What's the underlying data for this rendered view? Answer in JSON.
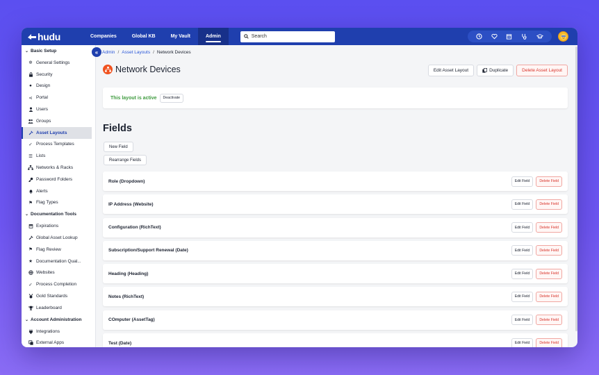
{
  "colors": {
    "nav_bg": "#1f3fae",
    "accent": "#2a57d8",
    "danger": "#d8332a",
    "success": "#3f9b3f",
    "title_icon": "#f0521f"
  },
  "brand": {
    "name": "hudu"
  },
  "nav": {
    "items": [
      {
        "label": "Companies"
      },
      {
        "label": "Global KB"
      },
      {
        "label": "My Vault"
      },
      {
        "label": "Admin",
        "active": true
      }
    ],
    "search_placeholder": "Search",
    "icons": [
      "clock-icon",
      "heart-icon",
      "calendar-icon",
      "stethoscope-icon",
      "graduation-cap-icon"
    ]
  },
  "sidebar": {
    "sections": [
      {
        "title": "Basic Setup",
        "items": [
          {
            "label": "General Settings",
            "icon": "gear-icon"
          },
          {
            "label": "Security",
            "icon": "lock-icon"
          },
          {
            "label": "Design",
            "icon": "palette-icon"
          },
          {
            "label": "Portal",
            "icon": "share-icon"
          },
          {
            "label": "Users",
            "icon": "user-icon"
          },
          {
            "label": "Groups",
            "icon": "users-icon"
          },
          {
            "label": "Asset Layouts",
            "icon": "wrench-icon",
            "active": true
          },
          {
            "label": "Process Templates",
            "icon": "check-icon"
          },
          {
            "label": "Lists",
            "icon": "list-icon"
          },
          {
            "label": "Networks & Racks",
            "icon": "network-icon"
          },
          {
            "label": "Password Folders",
            "icon": "key-icon"
          },
          {
            "label": "Alerts",
            "icon": "bell-icon"
          },
          {
            "label": "Flag Types",
            "icon": "flag-icon"
          }
        ]
      },
      {
        "title": "Documentation Tools",
        "items": [
          {
            "label": "Expirations",
            "icon": "calendar-icon"
          },
          {
            "label": "Global Asset Lookup",
            "icon": "wrench-icon"
          },
          {
            "label": "Flag Review",
            "icon": "flag-icon"
          },
          {
            "label": "Documentation Qual...",
            "icon": "star-icon"
          },
          {
            "label": "Websites",
            "icon": "globe-icon"
          },
          {
            "label": "Process Completion",
            "icon": "check-icon"
          },
          {
            "label": "Gold Standards",
            "icon": "medal-icon"
          },
          {
            "label": "Leaderboard",
            "icon": "trophy-icon"
          }
        ]
      },
      {
        "title": "Account Administration",
        "items": [
          {
            "label": "Integrations",
            "icon": "plug-icon"
          },
          {
            "label": "External Apps",
            "icon": "apps-icon"
          }
        ]
      }
    ]
  },
  "breadcrumb": {
    "admin": "Admin",
    "asset_layouts": "Asset Layouts",
    "current": "Network Devices",
    "sep": "/"
  },
  "page": {
    "title": "Network Devices",
    "edit_layout_label": "Edit Asset Layout",
    "duplicate_label": "Duplicate",
    "delete_layout_label": "Delete Asset Layout",
    "status_text": "This layout is active",
    "deactivate_label": "Deactivate",
    "fields_heading": "Fields",
    "new_field_label": "New Field",
    "rearrange_label": "Rearrange Fields"
  },
  "fields": {
    "edit_label": "Edit Field",
    "delete_label": "Delete Field",
    "rows": [
      {
        "name": "Role (Dropdown)"
      },
      {
        "name": "IP Address (Website)"
      },
      {
        "name": "Configuration (RichText)"
      },
      {
        "name": "Subscription/Support Renewal (Date)"
      },
      {
        "name": "Heading (Heading)"
      },
      {
        "name": "Notes (RichText)"
      },
      {
        "name": "COmputer (AssetTag)"
      },
      {
        "name": "Test (Date)"
      }
    ]
  }
}
